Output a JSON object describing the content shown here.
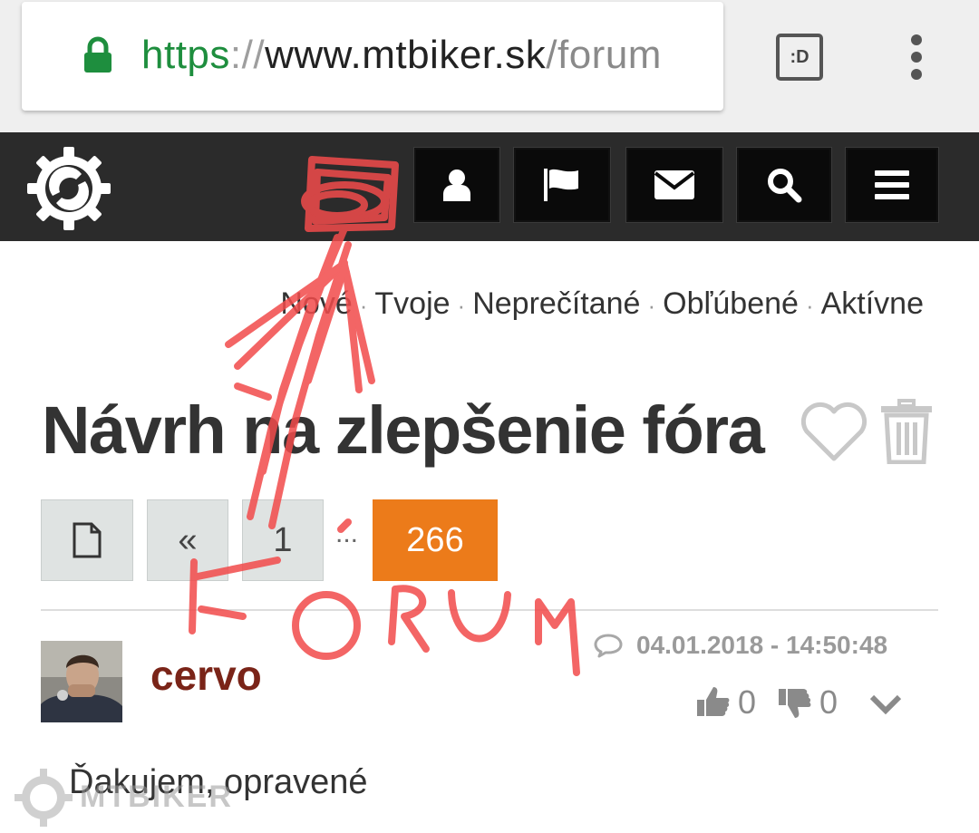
{
  "browser": {
    "url_scheme": "https",
    "url_separator": "://",
    "url_host": "www.mtbiker.sk",
    "url_path": "/forum",
    "tab_switch_label": ":D"
  },
  "header": {
    "nav_buttons": [
      {
        "icon": "user-icon"
      },
      {
        "icon": "flag-icon"
      },
      {
        "icon": "envelope-icon"
      },
      {
        "icon": "search-icon"
      },
      {
        "icon": "hamburger-menu-icon"
      }
    ]
  },
  "subnav": {
    "items": [
      "Nové",
      "Tvoje",
      "Neprečítané",
      "Obľúbené",
      "Aktívne"
    ],
    "separator": "·"
  },
  "thread": {
    "title": "Návrh na zlepšenie fóra"
  },
  "pagination": {
    "first_label": "«",
    "page_first": "1",
    "ellipsis": "...",
    "current": "266"
  },
  "post": {
    "author": "cervo",
    "date": "04.01.2018 - 14:50:48",
    "likes": "0",
    "dislikes": "0",
    "body": "Ďakujem, opravené"
  },
  "watermark": {
    "text": "MTBIKER"
  },
  "annotation": {
    "text": "FÓRUM",
    "color": "#f24b4b"
  },
  "colors": {
    "header_bg": "#2b2b2b",
    "current_page": "#ec7b1a",
    "author": "#7a2418",
    "secure_green": "#1e8e3e"
  }
}
